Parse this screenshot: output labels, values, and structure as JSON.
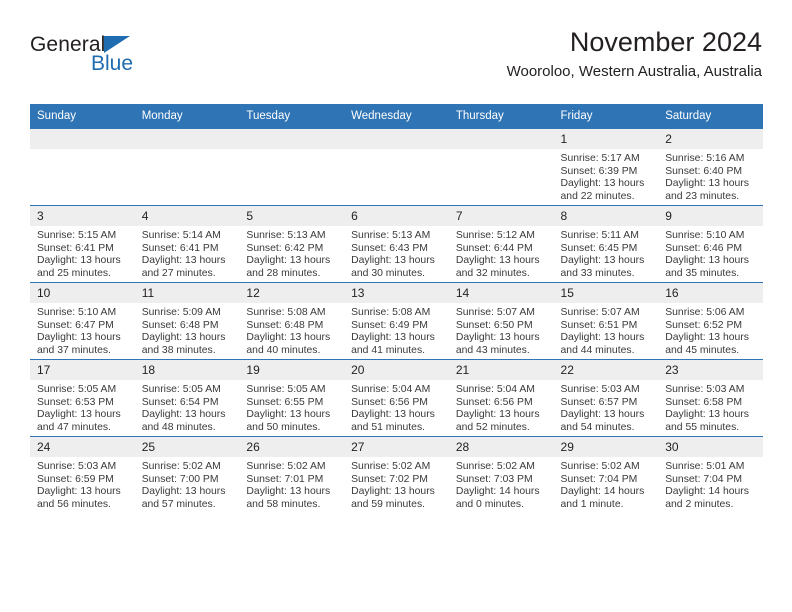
{
  "brand": {
    "name_part1": "General",
    "name_part2": "Blue",
    "triangle_color": "#1f6cb0"
  },
  "header": {
    "title": "November 2024",
    "subtitle": "Wooroloo, Western Australia, Australia"
  },
  "theme": {
    "header_blue": "#2f74b5",
    "daynum_gray": "#eeeeee",
    "text": "#231f20"
  },
  "calendar": {
    "weekday_headers": [
      "Sunday",
      "Monday",
      "Tuesday",
      "Wednesday",
      "Thursday",
      "Friday",
      "Saturday"
    ],
    "weeks": [
      [
        {
          "day": "",
          "empty": true,
          "sunrise": "",
          "sunset": "",
          "daylight1": "",
          "daylight2": ""
        },
        {
          "day": "",
          "empty": true,
          "sunrise": "",
          "sunset": "",
          "daylight1": "",
          "daylight2": ""
        },
        {
          "day": "",
          "empty": true,
          "sunrise": "",
          "sunset": "",
          "daylight1": "",
          "daylight2": ""
        },
        {
          "day": "",
          "empty": true,
          "sunrise": "",
          "sunset": "",
          "daylight1": "",
          "daylight2": ""
        },
        {
          "day": "",
          "empty": true,
          "sunrise": "",
          "sunset": "",
          "daylight1": "",
          "daylight2": ""
        },
        {
          "day": "1",
          "sunrise": "Sunrise: 5:17 AM",
          "sunset": "Sunset: 6:39 PM",
          "daylight1": "Daylight: 13 hours",
          "daylight2": "and 22 minutes."
        },
        {
          "day": "2",
          "sunrise": "Sunrise: 5:16 AM",
          "sunset": "Sunset: 6:40 PM",
          "daylight1": "Daylight: 13 hours",
          "daylight2": "and 23 minutes."
        }
      ],
      [
        {
          "day": "3",
          "sunrise": "Sunrise: 5:15 AM",
          "sunset": "Sunset: 6:41 PM",
          "daylight1": "Daylight: 13 hours",
          "daylight2": "and 25 minutes."
        },
        {
          "day": "4",
          "sunrise": "Sunrise: 5:14 AM",
          "sunset": "Sunset: 6:41 PM",
          "daylight1": "Daylight: 13 hours",
          "daylight2": "and 27 minutes."
        },
        {
          "day": "5",
          "sunrise": "Sunrise: 5:13 AM",
          "sunset": "Sunset: 6:42 PM",
          "daylight1": "Daylight: 13 hours",
          "daylight2": "and 28 minutes."
        },
        {
          "day": "6",
          "sunrise": "Sunrise: 5:13 AM",
          "sunset": "Sunset: 6:43 PM",
          "daylight1": "Daylight: 13 hours",
          "daylight2": "and 30 minutes."
        },
        {
          "day": "7",
          "sunrise": "Sunrise: 5:12 AM",
          "sunset": "Sunset: 6:44 PM",
          "daylight1": "Daylight: 13 hours",
          "daylight2": "and 32 minutes."
        },
        {
          "day": "8",
          "sunrise": "Sunrise: 5:11 AM",
          "sunset": "Sunset: 6:45 PM",
          "daylight1": "Daylight: 13 hours",
          "daylight2": "and 33 minutes."
        },
        {
          "day": "9",
          "sunrise": "Sunrise: 5:10 AM",
          "sunset": "Sunset: 6:46 PM",
          "daylight1": "Daylight: 13 hours",
          "daylight2": "and 35 minutes."
        }
      ],
      [
        {
          "day": "10",
          "sunrise": "Sunrise: 5:10 AM",
          "sunset": "Sunset: 6:47 PM",
          "daylight1": "Daylight: 13 hours",
          "daylight2": "and 37 minutes."
        },
        {
          "day": "11",
          "sunrise": "Sunrise: 5:09 AM",
          "sunset": "Sunset: 6:48 PM",
          "daylight1": "Daylight: 13 hours",
          "daylight2": "and 38 minutes."
        },
        {
          "day": "12",
          "sunrise": "Sunrise: 5:08 AM",
          "sunset": "Sunset: 6:48 PM",
          "daylight1": "Daylight: 13 hours",
          "daylight2": "and 40 minutes."
        },
        {
          "day": "13",
          "sunrise": "Sunrise: 5:08 AM",
          "sunset": "Sunset: 6:49 PM",
          "daylight1": "Daylight: 13 hours",
          "daylight2": "and 41 minutes."
        },
        {
          "day": "14",
          "sunrise": "Sunrise: 5:07 AM",
          "sunset": "Sunset: 6:50 PM",
          "daylight1": "Daylight: 13 hours",
          "daylight2": "and 43 minutes."
        },
        {
          "day": "15",
          "sunrise": "Sunrise: 5:07 AM",
          "sunset": "Sunset: 6:51 PM",
          "daylight1": "Daylight: 13 hours",
          "daylight2": "and 44 minutes."
        },
        {
          "day": "16",
          "sunrise": "Sunrise: 5:06 AM",
          "sunset": "Sunset: 6:52 PM",
          "daylight1": "Daylight: 13 hours",
          "daylight2": "and 45 minutes."
        }
      ],
      [
        {
          "day": "17",
          "sunrise": "Sunrise: 5:05 AM",
          "sunset": "Sunset: 6:53 PM",
          "daylight1": "Daylight: 13 hours",
          "daylight2": "and 47 minutes."
        },
        {
          "day": "18",
          "sunrise": "Sunrise: 5:05 AM",
          "sunset": "Sunset: 6:54 PM",
          "daylight1": "Daylight: 13 hours",
          "daylight2": "and 48 minutes."
        },
        {
          "day": "19",
          "sunrise": "Sunrise: 5:05 AM",
          "sunset": "Sunset: 6:55 PM",
          "daylight1": "Daylight: 13 hours",
          "daylight2": "and 50 minutes."
        },
        {
          "day": "20",
          "sunrise": "Sunrise: 5:04 AM",
          "sunset": "Sunset: 6:56 PM",
          "daylight1": "Daylight: 13 hours",
          "daylight2": "and 51 minutes."
        },
        {
          "day": "21",
          "sunrise": "Sunrise: 5:04 AM",
          "sunset": "Sunset: 6:56 PM",
          "daylight1": "Daylight: 13 hours",
          "daylight2": "and 52 minutes."
        },
        {
          "day": "22",
          "sunrise": "Sunrise: 5:03 AM",
          "sunset": "Sunset: 6:57 PM",
          "daylight1": "Daylight: 13 hours",
          "daylight2": "and 54 minutes."
        },
        {
          "day": "23",
          "sunrise": "Sunrise: 5:03 AM",
          "sunset": "Sunset: 6:58 PM",
          "daylight1": "Daylight: 13 hours",
          "daylight2": "and 55 minutes."
        }
      ],
      [
        {
          "day": "24",
          "sunrise": "Sunrise: 5:03 AM",
          "sunset": "Sunset: 6:59 PM",
          "daylight1": "Daylight: 13 hours",
          "daylight2": "and 56 minutes."
        },
        {
          "day": "25",
          "sunrise": "Sunrise: 5:02 AM",
          "sunset": "Sunset: 7:00 PM",
          "daylight1": "Daylight: 13 hours",
          "daylight2": "and 57 minutes."
        },
        {
          "day": "26",
          "sunrise": "Sunrise: 5:02 AM",
          "sunset": "Sunset: 7:01 PM",
          "daylight1": "Daylight: 13 hours",
          "daylight2": "and 58 minutes."
        },
        {
          "day": "27",
          "sunrise": "Sunrise: 5:02 AM",
          "sunset": "Sunset: 7:02 PM",
          "daylight1": "Daylight: 13 hours",
          "daylight2": "and 59 minutes."
        },
        {
          "day": "28",
          "sunrise": "Sunrise: 5:02 AM",
          "sunset": "Sunset: 7:03 PM",
          "daylight1": "Daylight: 14 hours",
          "daylight2": "and 0 minutes."
        },
        {
          "day": "29",
          "sunrise": "Sunrise: 5:02 AM",
          "sunset": "Sunset: 7:04 PM",
          "daylight1": "Daylight: 14 hours",
          "daylight2": "and 1 minute."
        },
        {
          "day": "30",
          "sunrise": "Sunrise: 5:01 AM",
          "sunset": "Sunset: 7:04 PM",
          "daylight1": "Daylight: 14 hours",
          "daylight2": "and 2 minutes."
        }
      ]
    ]
  }
}
